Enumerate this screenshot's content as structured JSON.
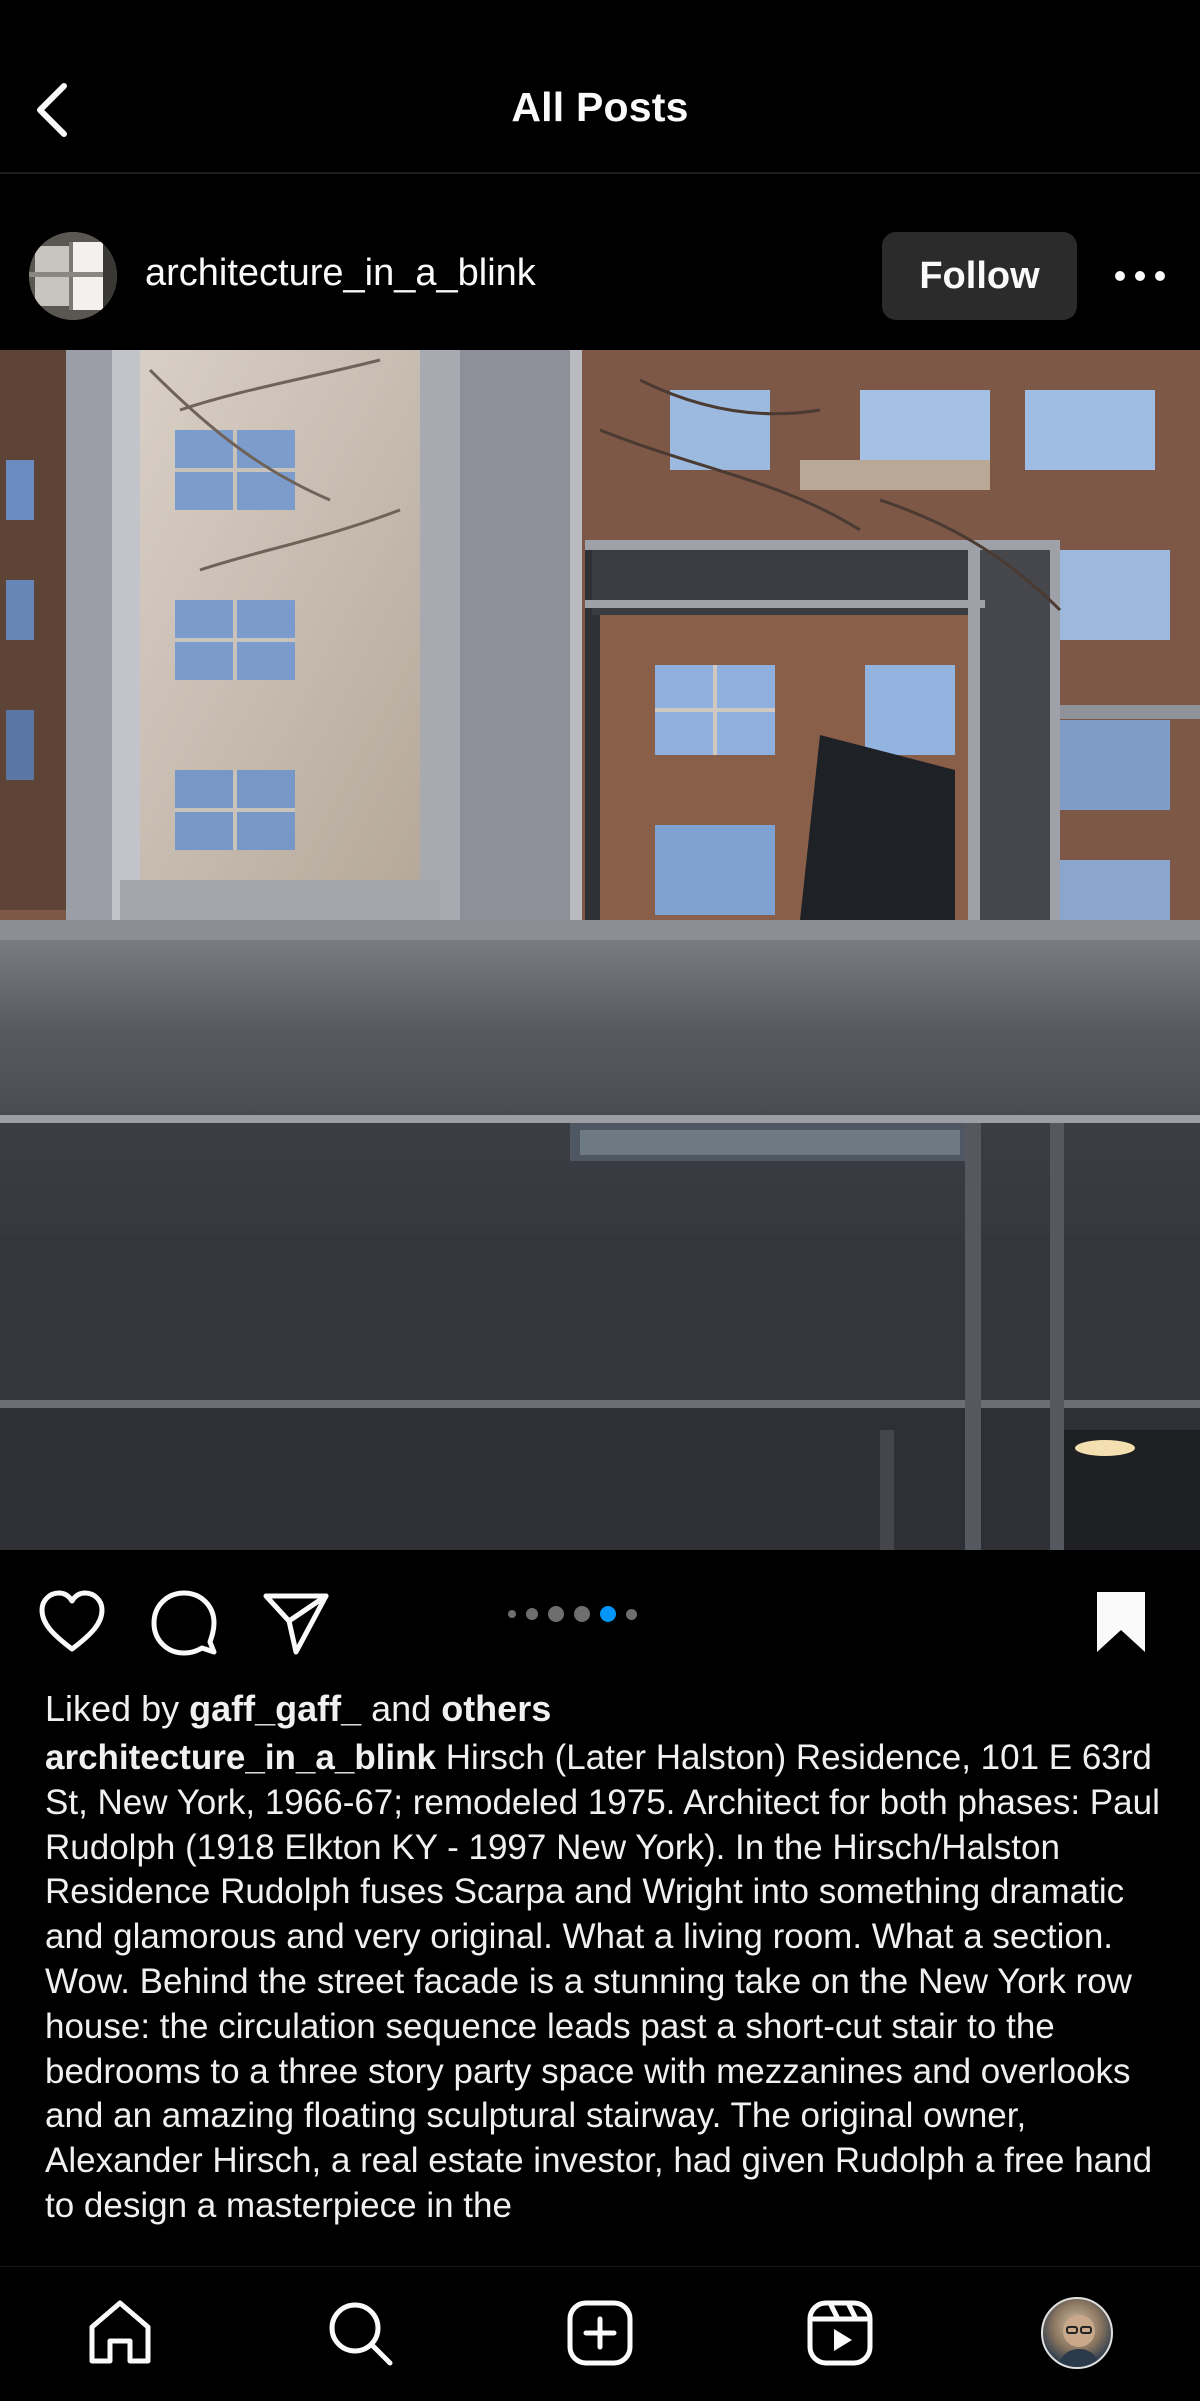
{
  "header": {
    "title": "All Posts",
    "back_icon": "chevron-left-icon"
  },
  "post": {
    "username": "architecture_in_a_blink",
    "follow_label": "Follow",
    "more_icon": "more-horizontal-icon",
    "carousel": {
      "total": 6,
      "active_index": 4
    },
    "liked_by_prefix": "Liked by ",
    "liked_by_user": "gaff_gaff_",
    "liked_by_mid": " and ",
    "liked_by_others": "others",
    "caption_user": "architecture_in_a_blink",
    "caption_text": " Hirsch (Later Halston) Residence, 101 E 63rd St, New York, 1966-67; remodeled 1975. Architect for both phases: Paul Rudolph (1918 Elkton KY - 1997 New York). In the Hirsch/Halston Residence Rudolph fuses Scarpa and Wright into something dramatic and glamorous and very original. What a living room. What a section. Wow. Behind the street facade is a stunning take on the New York row house: the circulation sequence leads past a short-cut stair to the bedrooms to a three story party space with mezzanines and overlooks and an amazing floating sculptural stairway. The original owner, Alexander Hirsch, a real estate investor, had given Rudolph a free hand to design a masterpiece in the"
  },
  "actions": {
    "like_icon": "heart-icon",
    "comment_icon": "comment-icon",
    "share_icon": "send-icon",
    "save_icon": "bookmark-icon"
  },
  "tabbar": {
    "items": [
      "home-icon",
      "search-icon",
      "create-icon",
      "reels-icon",
      "profile-avatar"
    ]
  },
  "colors": {
    "background": "#000000",
    "accent_blue": "#0095f6",
    "follow_bg": "#2b2b2b"
  }
}
